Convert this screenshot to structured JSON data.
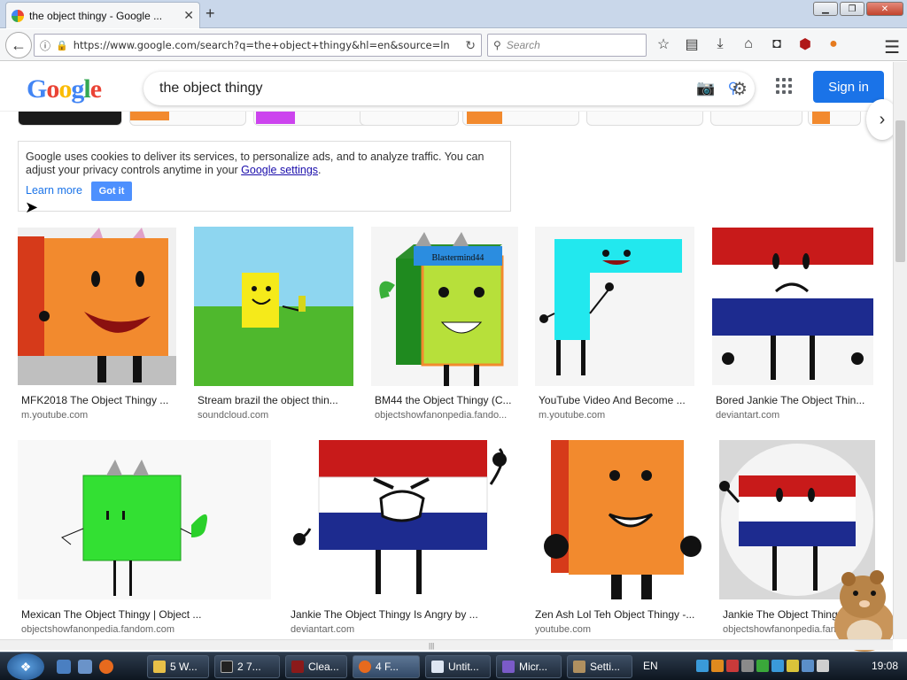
{
  "browser": {
    "tab_title": "the object thingy - Google ...",
    "tab_close": "✕",
    "new_tab": "+",
    "url": "https://www.google.com/search?q=the+object+thingy&hl=en&source=ln",
    "search_placeholder": "Search",
    "window_min": "▁",
    "window_max": "❐",
    "window_close": "✕"
  },
  "google": {
    "logo": [
      "G",
      "o",
      "o",
      "g",
      "l",
      "e"
    ],
    "query": "the object thingy",
    "sign_in": "Sign in"
  },
  "cookie": {
    "text": "Google uses cookies to deliver its services, to personalize ads, and to analyze traffic. You can adjust your privacy controls anytime in your ",
    "link": "Google settings",
    "period": ".",
    "learn_more": "Learn more",
    "got_it": "Got it"
  },
  "results": [
    {
      "title": "MFK2018 The Object Thingy ...",
      "source": "m.youtube.com",
      "color": "#f28a2e"
    },
    {
      "title": "Stream brazil the object thin...",
      "source": "soundcloud.com",
      "color": "#5cb83a"
    },
    {
      "title": "BM44 the Object Thingy (C...",
      "source": "objectshowfanonpedia.fando...",
      "color": "#8fd634"
    },
    {
      "title": "YouTube Video And Become ...",
      "source": "m.youtube.com",
      "color": "#22e8ee"
    },
    {
      "title": "Bored Jankie The Object Thin...",
      "source": "deviantart.com",
      "color": "#1d2b8f"
    },
    {
      "title": "Mexican The Object Thingy | Object ...",
      "source": "objectshowfanonpedia.fandom.com",
      "color": "#33e033"
    },
    {
      "title": "Jankie The Object Thingy Is Angry by ...",
      "source": "deviantart.com",
      "color": "#1d2b8f"
    },
    {
      "title": "Zen Ash Lol Teh Object Thingy -...",
      "source": "youtube.com",
      "color": "#f28a2e"
    },
    {
      "title": "Jankie The Object Thingy",
      "source": "objectshowfanonpedia.fandom.com",
      "color": "#1d2b8f"
    }
  ],
  "taskbar": {
    "buttons": [
      "5 W...",
      "2 7...",
      "Clea...",
      "4 F...",
      "Untit...",
      "Micr...",
      "Setti..."
    ],
    "lang": "EN",
    "clock": "19:08"
  }
}
